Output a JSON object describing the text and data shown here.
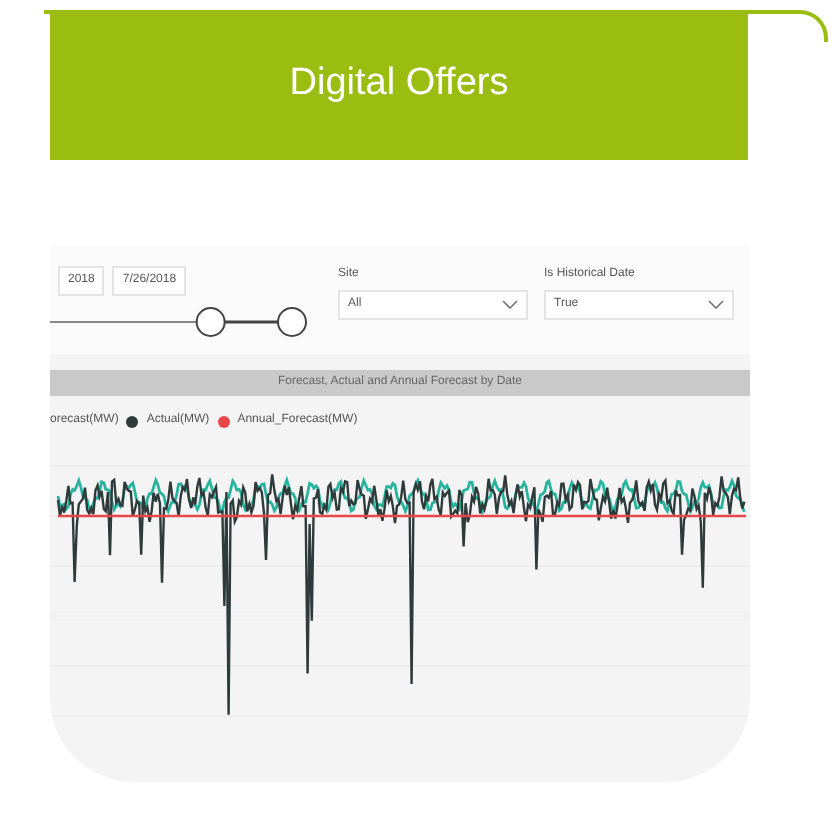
{
  "header": {
    "title": "Digital Offers"
  },
  "dashboard": {
    "date_range": {
      "start": "2018",
      "end": "7/26/2018"
    },
    "slider_thumbs": [
      {
        "level": 0.64
      },
      {
        "level": 1
      }
    ],
    "filters": [
      {
        "label": "Site",
        "value": "All"
      },
      {
        "label": "Is Historical Date",
        "value": "True"
      }
    ],
    "chart_title": "Forecast, Actual and Annual Forecast by Date",
    "legend": [
      {
        "label": "orecast(MW)"
      },
      {
        "label": "Actual(MW)",
        "color": "#2f3b3b"
      },
      {
        "label": "Annual_Forecast(MW)",
        "color": "#e8474a"
      }
    ]
  }
}
